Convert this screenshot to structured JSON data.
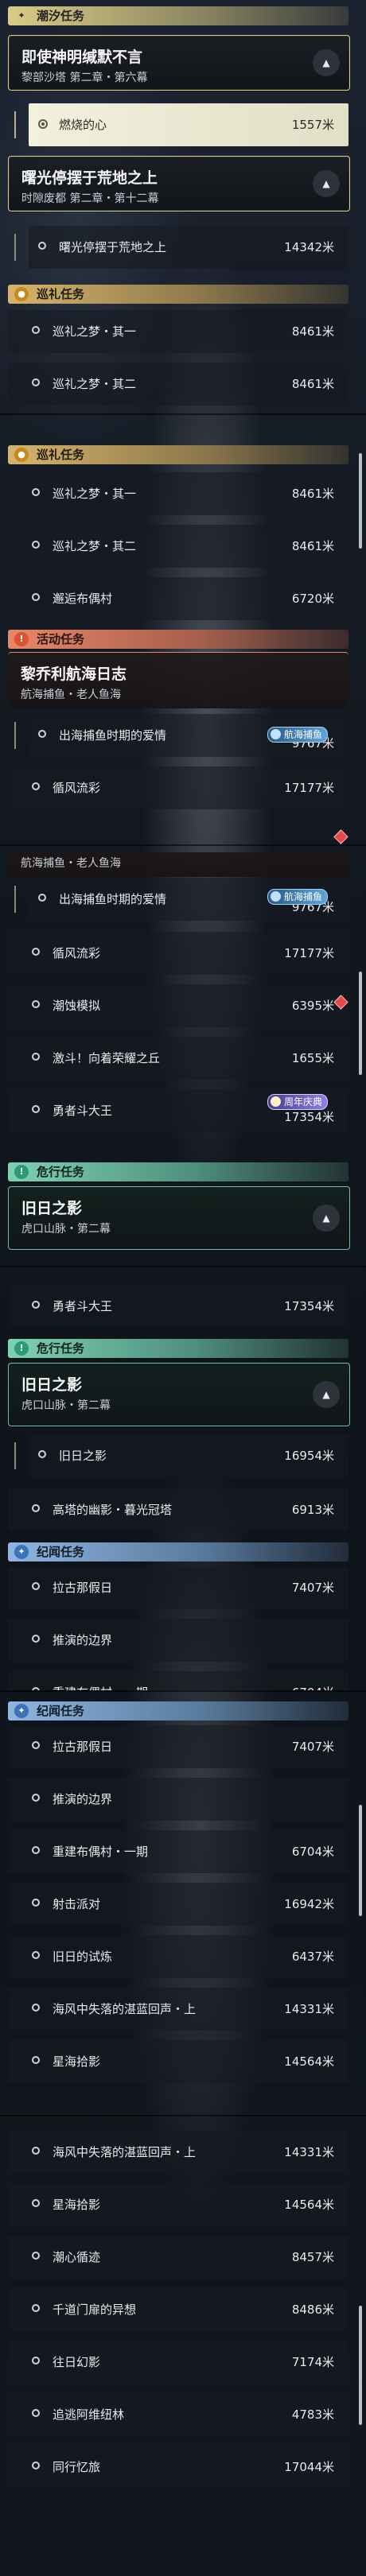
{
  "categories": {
    "tide": "潮汐任务",
    "tour": "巡礼任务",
    "event": "活动任务",
    "danger": "危行任务",
    "lore": "纪闻任务"
  },
  "quests": {
    "silence": {
      "title": "即使神明缄默不言",
      "subtitle": "黎部沙塔 第二章・第六幕"
    },
    "dawn": {
      "title": "曙光停摆于荒地之上",
      "subtitle": "时隙废都 第二章・第十二幕"
    },
    "sailing": {
      "title": "黎乔利航海日志",
      "subtitle": "航海捕鱼・老人鱼海"
    },
    "shadow": {
      "title": "旧日之影",
      "subtitle": "虎口山脉・第二幕"
    }
  },
  "tasks": {
    "burning_heart": {
      "label": "燃烧的心",
      "distance": "1557米"
    },
    "dawn_step": {
      "label": "曙光停摆于荒地之上",
      "distance": "14342米"
    },
    "dream_1": {
      "label": "巡礼之梦・其一",
      "distance": "8461米"
    },
    "dream_2": {
      "label": "巡礼之梦・其二",
      "distance": "8461米"
    },
    "bugu": {
      "label": "邂逅布偶村",
      "distance": "6720米"
    },
    "love": {
      "label": "出海捕鱼时期的爱情",
      "distance": "9767米"
    },
    "rapids": {
      "label": "循风流彩",
      "distance": "17177米"
    },
    "tide_sim": {
      "label": "潮蚀模拟",
      "distance": "6395米"
    },
    "glory": {
      "label": "激斗！向着荣耀之丘",
      "distance": "1655米"
    },
    "brave": {
      "label": "勇者斗大王",
      "distance": "17354米"
    },
    "shadow_step": {
      "label": "旧日之影",
      "distance": "16954米"
    },
    "tower": {
      "label": "高塔的幽影・暮光冠塔",
      "distance": "6913米"
    },
    "old_days": {
      "label": "拉古那假日",
      "distance": "7407米"
    },
    "edge": {
      "label": "推演的边界",
      "distance": ""
    },
    "rebuild": {
      "label": "重建布偶村・一期",
      "distance": "6704米"
    },
    "shooting": {
      "label": "射击派对",
      "distance": "16942米"
    },
    "trial": {
      "label": "旧日的试炼",
      "distance": "6437米"
    },
    "lost_ocean": {
      "label": "海风中失落的湛蓝回声・上",
      "distance": "14331米"
    },
    "star": {
      "label": "星海拾影",
      "distance": "14564米"
    },
    "tidal_heart": {
      "label": "潮心循迹",
      "distance": "8457米"
    },
    "thousand": {
      "label": "千道门扉的异想",
      "distance": "8486米"
    },
    "past_illusion": {
      "label": "往日幻影",
      "distance": "7174米"
    },
    "pursue": {
      "label": "追逃阿维纽林",
      "distance": "4783米"
    },
    "together": {
      "label": "同行忆旅",
      "distance": "17044米"
    }
  },
  "badges": {
    "fishing": "航海捕鱼",
    "anniversary": "周年庆典"
  },
  "icons": {
    "tide": "sparkle-icon",
    "tour": "map-pin-icon",
    "event": "event-flag-icon",
    "danger": "danger-icon",
    "lore": "sparkle-icon",
    "expand": "chevron-up-icon",
    "bullet": "circle-icon"
  },
  "colors": {
    "tide": "#d9cc86",
    "tour": "#d6b46a",
    "event": "#e8866b",
    "danger": "#7fd1b4",
    "lore": "#8fb5e0",
    "selected_row": "#f3f0dc",
    "alert": "#e24a4a"
  }
}
